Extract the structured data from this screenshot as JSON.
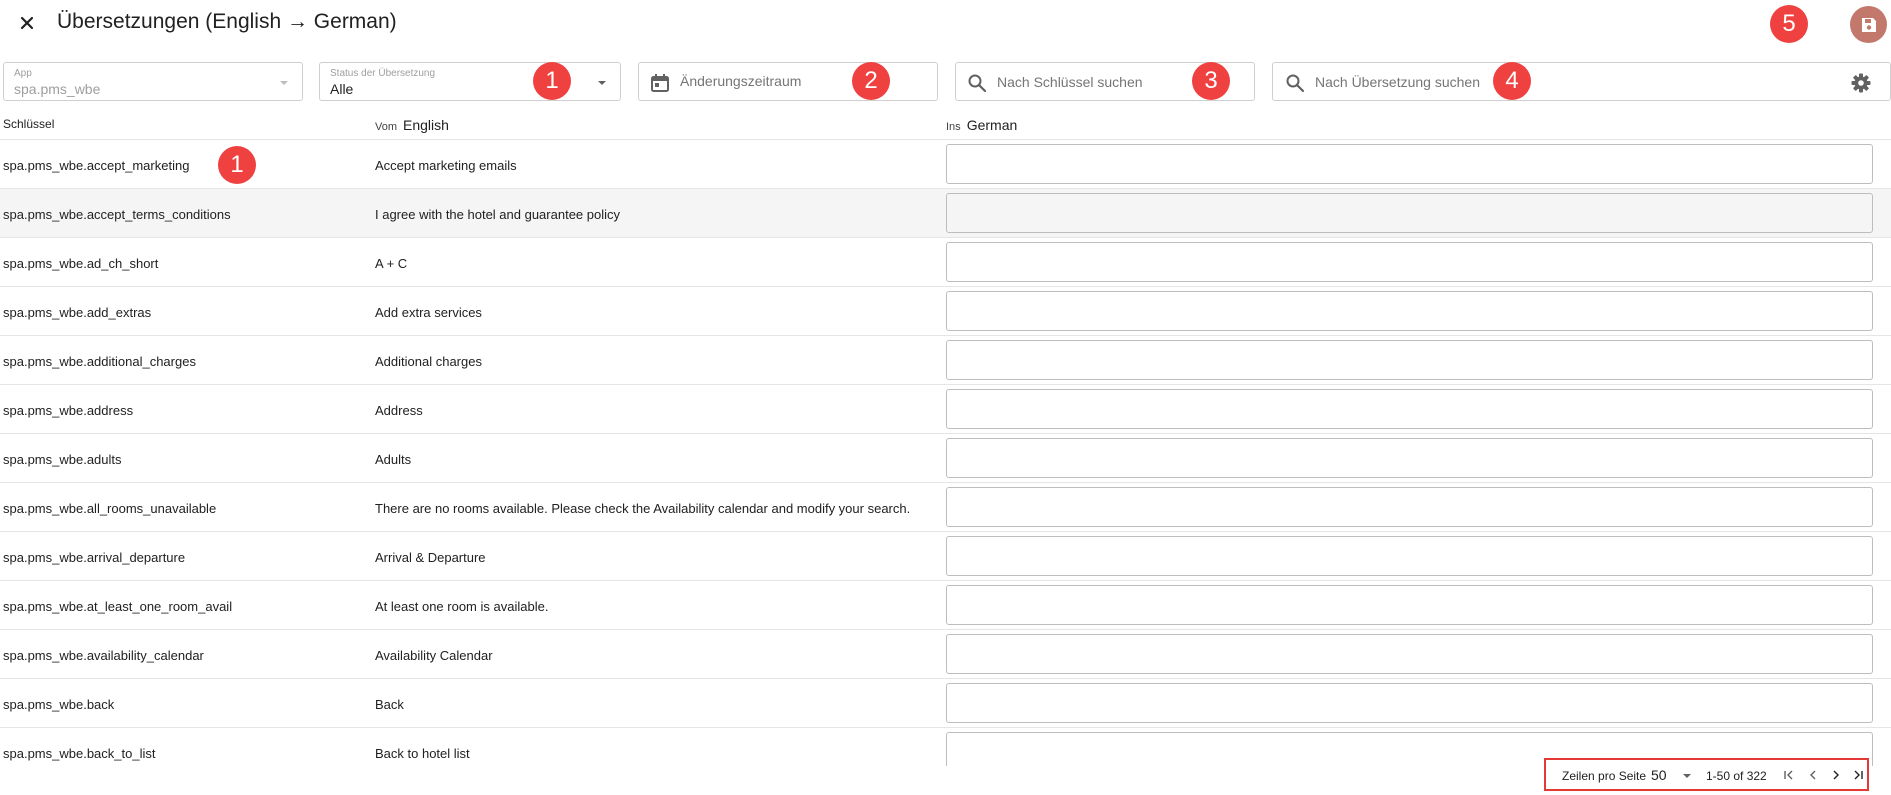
{
  "header": {
    "title": "Übersetzungen (English → German)"
  },
  "badges": [
    "1",
    "2",
    "3",
    "4",
    "5",
    "1"
  ],
  "filters": {
    "app": {
      "label": "App",
      "value": "spa.pms_wbe"
    },
    "status": {
      "label": "Status der Übersetzung",
      "value": "Alle"
    },
    "date_range": {
      "placeholder": "Änderungszeitraum"
    },
    "key_search": {
      "placeholder": "Nach Schlüssel suchen"
    },
    "translation_search": {
      "placeholder": "Nach Übersetzung suchen"
    }
  },
  "columns": {
    "key": "Schlüssel",
    "from_prefix": "Vom",
    "from_lang": "English",
    "to_prefix": "Ins",
    "to_lang": "German"
  },
  "rows": [
    {
      "key": "spa.pms_wbe.accept_marketing",
      "source": "Accept marketing emails",
      "translation": ""
    },
    {
      "key": "spa.pms_wbe.accept_terms_conditions",
      "source": "I agree with the hotel and guarantee policy",
      "translation": ""
    },
    {
      "key": "spa.pms_wbe.ad_ch_short",
      "source": "A + C",
      "translation": ""
    },
    {
      "key": "spa.pms_wbe.add_extras",
      "source": "Add extra services",
      "translation": ""
    },
    {
      "key": "spa.pms_wbe.additional_charges",
      "source": "Additional charges",
      "translation": ""
    },
    {
      "key": "spa.pms_wbe.address",
      "source": "Address",
      "translation": ""
    },
    {
      "key": "spa.pms_wbe.adults",
      "source": "Adults",
      "translation": ""
    },
    {
      "key": "spa.pms_wbe.all_rooms_unavailable",
      "source": "There are no rooms available. Please check the Availability calendar and modify your search.",
      "translation": ""
    },
    {
      "key": "spa.pms_wbe.arrival_departure",
      "source": "Arrival & Departure",
      "translation": ""
    },
    {
      "key": "spa.pms_wbe.at_least_one_room_avail",
      "source": "At least one room is available.",
      "translation": ""
    },
    {
      "key": "spa.pms_wbe.availability_calendar",
      "source": "Availability Calendar",
      "translation": ""
    },
    {
      "key": "spa.pms_wbe.back",
      "source": "Back",
      "translation": ""
    },
    {
      "key": "spa.pms_wbe.back_to_list",
      "source": "Back to hotel list",
      "translation": ""
    }
  ],
  "pagination": {
    "rows_per_page_label": "Zeilen pro Seite",
    "rows_per_page": "50",
    "range": "1-50 of 322"
  },
  "colors": {
    "badge": "#f04141",
    "save_button": "#c2786b",
    "highlight_border": "#e53935"
  },
  "icons": {
    "close": "close-icon",
    "save": "save-icon",
    "calendar": "calendar-icon",
    "search": "search-icon",
    "settings": "gear-icon"
  }
}
